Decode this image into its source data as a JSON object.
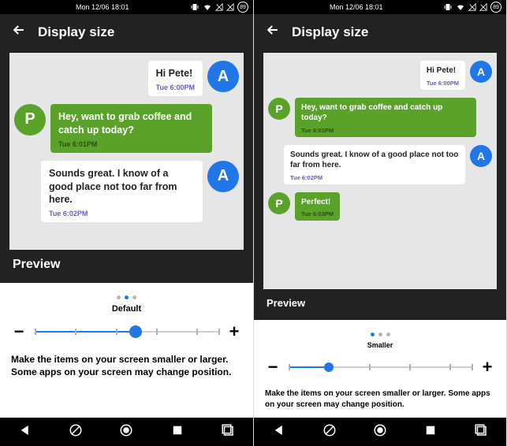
{
  "status": {
    "datetime": "Mon 12/06 18:01",
    "battery": "89"
  },
  "header": {
    "title": "Display size"
  },
  "preview_label": "Preview",
  "avatars": {
    "a": "A",
    "p": "P"
  },
  "messages": [
    {
      "side": "right",
      "avatar": "a",
      "style": "white",
      "text": "Hi Pete!",
      "time": "Tue 6:00PM"
    },
    {
      "side": "left",
      "avatar": "p",
      "style": "green",
      "text": "Hey, want to grab coffee and catch up today?",
      "time": "Tue 6:01PM"
    },
    {
      "side": "right",
      "avatar": "a",
      "style": "white",
      "text": "Sounds great. I know of a good place not too far from here.",
      "time": "Tue 6:02PM"
    },
    {
      "side": "left",
      "avatar": "p",
      "style": "green",
      "text": "Perfect!",
      "time": "Tue 6:03PM"
    }
  ],
  "left_panel": {
    "visible_message_count": 3,
    "size_label": "Default",
    "slider_pos_pct": 55,
    "active_dot": 1
  },
  "right_panel": {
    "visible_message_count": 4,
    "size_label": "Smaller",
    "slider_pos_pct": 22,
    "active_dot": 0
  },
  "tick_positions_pct": [
    0,
    22,
    44,
    66,
    88,
    100
  ],
  "controls": {
    "minus": "−",
    "plus": "+"
  },
  "description": "Make the items on your screen smaller or larger. Some apps on your screen may change position."
}
